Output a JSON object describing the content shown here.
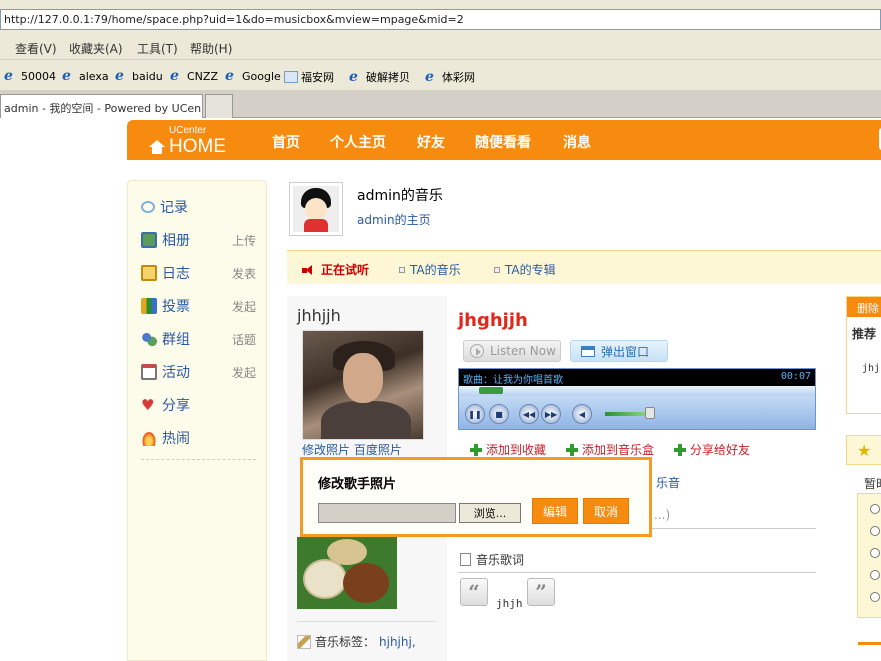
{
  "browser": {
    "url": "http://127.0.0.1:79/home/space.php?uid=1&do=musicbox&mview=mpage&mid=2",
    "menus": [
      "查看(V)",
      "收藏夹(A)",
      "工具(T)",
      "帮助(H)"
    ],
    "bookmarks": [
      "50004",
      "alexa",
      "baidu",
      "CNZZ",
      "Google",
      "福安网",
      "破解拷贝",
      "体彩网"
    ],
    "tab_title": "admin - 我的空间 - Powered by UCen..."
  },
  "header": {
    "logo_small": "UCenter",
    "logo_main": "HOME",
    "nav": [
      "首页",
      "个人主页",
      "好友",
      "随便看看",
      "消息"
    ]
  },
  "sidebar": {
    "items": [
      {
        "label": "记录",
        "sub": "",
        "icon": "speech-bubble-icon",
        "color": "#7fb0e0"
      },
      {
        "label": "相册",
        "sub": "上传",
        "icon": "photo-icon",
        "color": "#5a9a5a"
      },
      {
        "label": "日志",
        "sub": "发表",
        "icon": "journal-icon",
        "color": "#e0a820"
      },
      {
        "label": "投票",
        "sub": "发起",
        "icon": "bar-chart-icon",
        "color": "#2a8f2a"
      },
      {
        "label": "群组",
        "sub": "话题",
        "icon": "group-icon",
        "color": "#4b7ac8"
      },
      {
        "label": "活动",
        "sub": "发起",
        "icon": "calendar-icon",
        "color": "#c84b4b"
      },
      {
        "label": "分享",
        "sub": "",
        "icon": "heart-icon",
        "color": "#d83a3a"
      },
      {
        "label": "热闹",
        "sub": "",
        "icon": "fire-icon",
        "color": "#e8501a"
      }
    ]
  },
  "profile": {
    "title": "admin的音乐",
    "home_link": "admin的主页"
  },
  "subtabs": {
    "listening": "正在试听",
    "ta_music": "TA的音乐",
    "ta_album": "TA的专辑"
  },
  "singer": {
    "name": "jhhjjh",
    "edit_photo": "修改照片",
    "baidu_photo": "百度照片",
    "tags_label": "音乐标签：",
    "tags_value": "hjhjhj,"
  },
  "song": {
    "title": "jhghjjh",
    "listen_now": "Listen Now",
    "popup": "弹出窗口",
    "player_text": "歌曲：让我为你唱首歌",
    "player_time": "00:07",
    "actions": [
      "添加到收藏",
      "添加到音乐盒",
      "分享给好友"
    ],
    "partial_link": "乐音",
    "partial_paren": "...)",
    "lyrics_header": "音乐歌词",
    "lyrics": "jhjh"
  },
  "modal": {
    "title": "修改歌手照片",
    "browse": "浏览...",
    "edit": "编辑",
    "cancel": "取消"
  },
  "right": {
    "delete": "删除",
    "recommend": "推荐",
    "recommend_val": "jhj",
    "temp": "暂时"
  },
  "colors": {
    "accent": "#f78b0f",
    "link": "#2a59a6",
    "song_title": "#e3261b"
  }
}
